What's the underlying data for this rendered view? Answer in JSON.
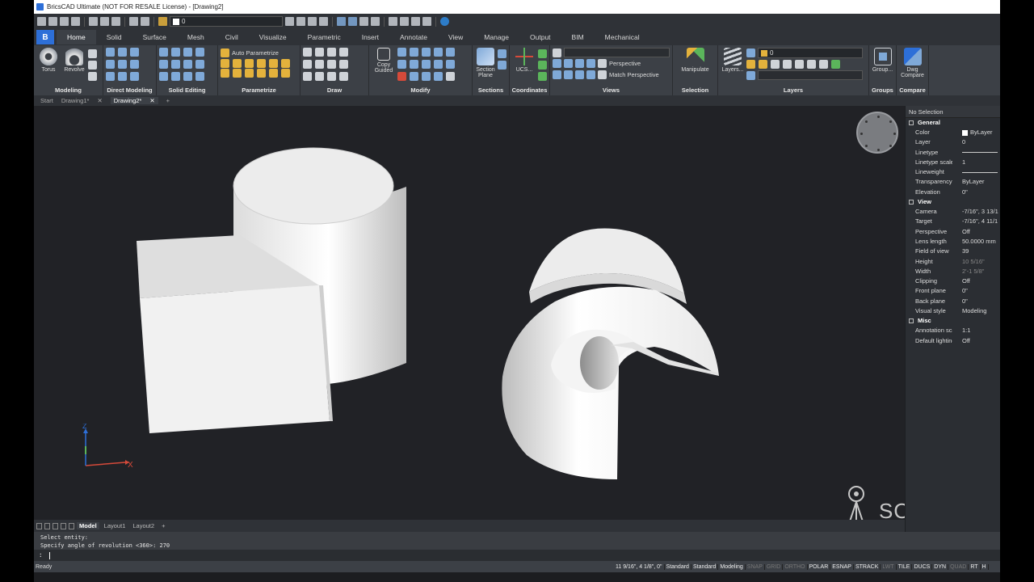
{
  "window": {
    "title": "BricsCAD Ultimate (NOT FOR RESALE License) - [Drawing2]"
  },
  "quick_access": {
    "layer_value": "0"
  },
  "ribbon_tabs": [
    "Home",
    "Solid",
    "Surface",
    "Mesh",
    "Civil",
    "Visualize",
    "Parametric",
    "Insert",
    "Annotate",
    "View",
    "Manage",
    "Output",
    "BIM",
    "Mechanical"
  ],
  "ribbon": {
    "modeling": {
      "title": "Modeling",
      "torus": "Torus",
      "revolve": "Revolve"
    },
    "direct_modeling": {
      "title": "Direct Modeling"
    },
    "solid_editing": {
      "title": "Solid Editing"
    },
    "parametrize": {
      "title": "Parametrize",
      "auto": "Auto Parametrize"
    },
    "draw": {
      "title": "Draw"
    },
    "modify": {
      "title": "Modify",
      "copy_guided_1": "Copy",
      "copy_guided_2": "Guided"
    },
    "sections": {
      "title": "Sections",
      "section_plane_1": "Section",
      "section_plane_2": "Plane"
    },
    "coordinates": {
      "title": "Coordinates",
      "ucs": "UCS..."
    },
    "views": {
      "title": "Views",
      "perspective": "Perspective",
      "match_perspective": "Match Perspective"
    },
    "selection": {
      "title": "Selection",
      "manipulate": "Manipulate"
    },
    "layers": {
      "title": "Layers",
      "layers_btn": "Layers...",
      "layer_value": "0"
    },
    "groups": {
      "title": "Groups",
      "group_btn": "Group..."
    },
    "compare": {
      "title": "Compare",
      "dwg_compare_1": "Dwg",
      "dwg_compare_2": "Compare"
    }
  },
  "doc_tabs": {
    "start": "Start",
    "drawing1": "Drawing1*",
    "drawing2": "Drawing2*",
    "add": "+"
  },
  "properties": {
    "header": "No Selection",
    "general_title": "General",
    "general": [
      {
        "k": "Color",
        "v": "ByLayer"
      },
      {
        "k": "Layer",
        "v": "0"
      },
      {
        "k": "Linetype",
        "v": ""
      },
      {
        "k": "Linetype scale",
        "v": "1"
      },
      {
        "k": "Lineweight",
        "v": ""
      },
      {
        "k": "Transparency",
        "v": "ByLayer"
      },
      {
        "k": "Elevation",
        "v": "0\""
      }
    ],
    "view_title": "View",
    "view": [
      {
        "k": "Camera",
        "v": "-7/16\", 3 13/1"
      },
      {
        "k": "Target",
        "v": "-7/16\", 4 11/1"
      },
      {
        "k": "Perspective",
        "v": "Off"
      },
      {
        "k": "Lens length",
        "v": "50.0000 mm"
      },
      {
        "k": "Field of view",
        "v": "39"
      },
      {
        "k": "Height",
        "v": "10 5/16\""
      },
      {
        "k": "Width",
        "v": "2'-1 5/8\""
      },
      {
        "k": "Clipping",
        "v": "Off"
      },
      {
        "k": "Front plane",
        "v": "0\""
      },
      {
        "k": "Back plane",
        "v": "0\""
      },
      {
        "k": "Visual style",
        "v": "Modeling"
      }
    ],
    "misc_title": "Misc",
    "misc": [
      {
        "k": "Annotation scale",
        "v": "1:1"
      },
      {
        "k": "Default lighting",
        "v": "Off"
      }
    ]
  },
  "layout_tabs": {
    "model": "Model",
    "layout1": "Layout1",
    "layout2": "Layout2",
    "add": "+"
  },
  "command": {
    "history_1": "Select entity:",
    "history_2": "Specify angle of revolution <360>: 270",
    "prompt": ":"
  },
  "status": {
    "ready": "Ready",
    "coords": "11 9/16\", 4 1/8\", 0\"",
    "items": [
      {
        "label": "Standard",
        "on": true
      },
      {
        "label": "Standard",
        "on": true
      },
      {
        "label": "Modeling",
        "on": true
      },
      {
        "label": "SNAP",
        "on": false
      },
      {
        "label": "GRID",
        "on": false
      },
      {
        "label": "ORTHO",
        "on": false
      },
      {
        "label": "POLAR",
        "on": true
      },
      {
        "label": "ESNAP",
        "on": true
      },
      {
        "label": "STRACK",
        "on": true
      },
      {
        "label": "LWT",
        "on": false
      },
      {
        "label": "TILE",
        "on": true
      },
      {
        "label": "DUCS",
        "on": true
      },
      {
        "label": "DYN",
        "on": true
      },
      {
        "label": "QUAD",
        "on": false
      },
      {
        "label": "RT",
        "on": true
      },
      {
        "label": "H",
        "on": true
      }
    ]
  },
  "ucs_icon": {
    "x_label": "X",
    "y_label": "Y",
    "z_label": "Z"
  },
  "watermark": {
    "text": "SOURCEC"
  }
}
